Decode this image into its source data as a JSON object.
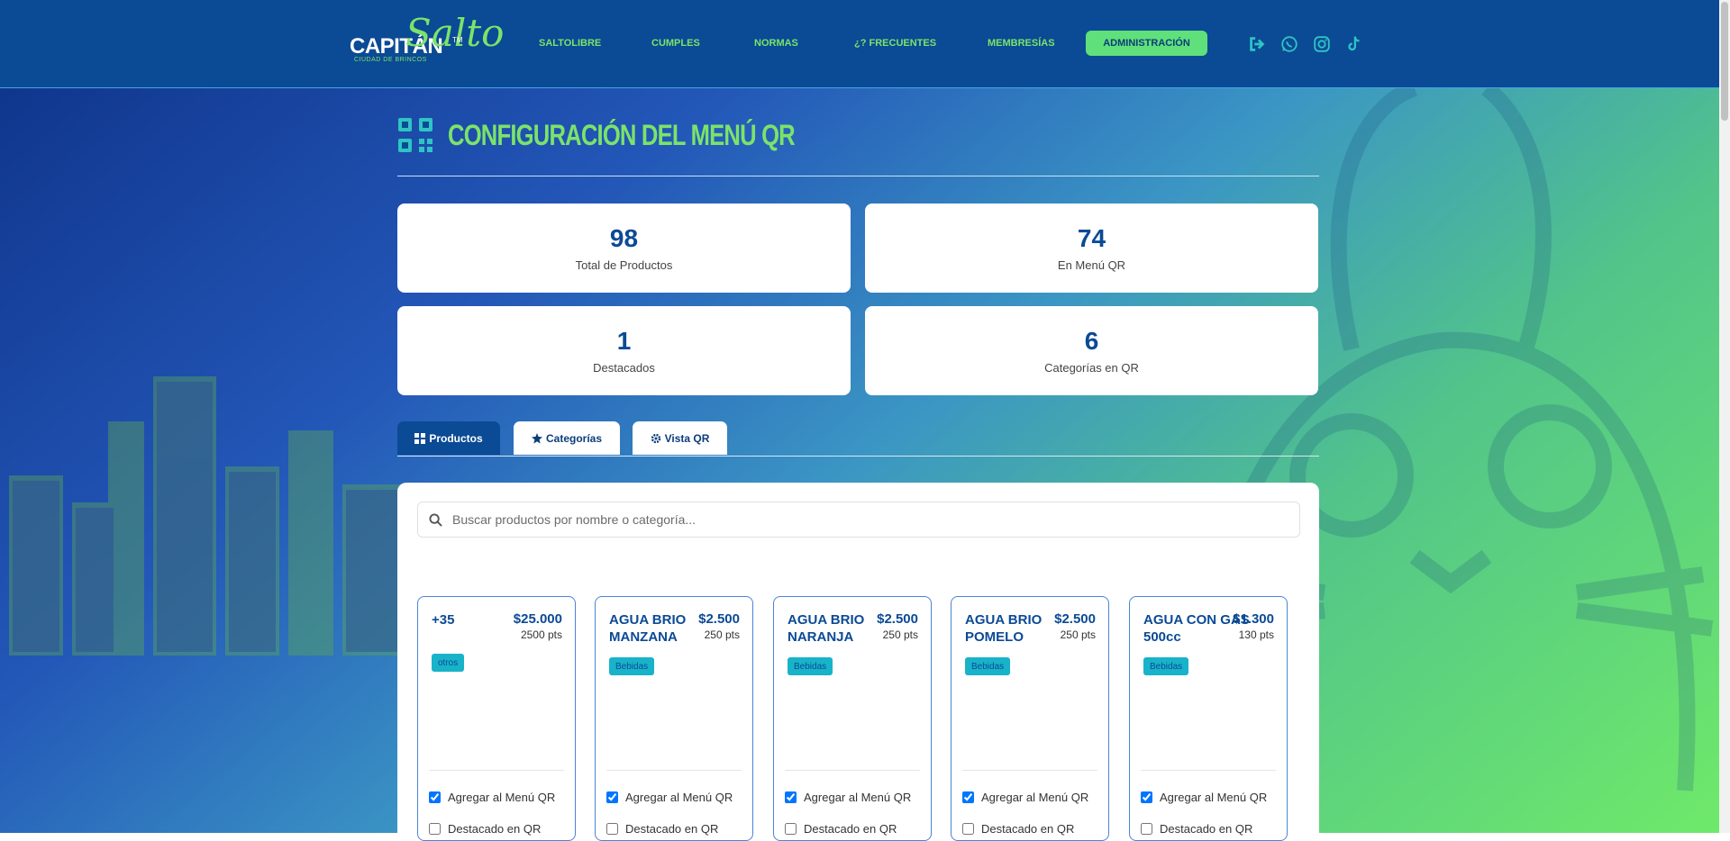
{
  "header": {
    "logo": {
      "main": "CAPITÁN",
      "script": "Salto",
      "tm": "TM",
      "tagline": "CIUDAD DE BRINCOS"
    },
    "nav": [
      "SALTOLIBRE",
      "CUMPLES",
      "NORMAS",
      "¿? FRECUENTES",
      "MEMBRESÍAS"
    ],
    "admin_label": "ADMINISTRACIÓN",
    "icons": [
      "logout-icon",
      "whatsapp-icon",
      "instagram-icon",
      "tiktok-icon"
    ]
  },
  "page": {
    "title": "CONFIGURACIÓN DEL MENÚ QR"
  },
  "stats": [
    {
      "value": "98",
      "label": "Total de Productos"
    },
    {
      "value": "74",
      "label": "En Menú QR"
    },
    {
      "value": "1",
      "label": "Destacados"
    },
    {
      "value": "6",
      "label": "Categorías en QR"
    }
  ],
  "tabs": [
    {
      "label": "Productos",
      "icon": "grid-icon",
      "active": true
    },
    {
      "label": "Categorías",
      "icon": "star-icon",
      "active": false
    },
    {
      "label": "Vista QR",
      "icon": "gear-icon",
      "active": false
    }
  ],
  "search": {
    "placeholder": "Buscar productos por nombre o categoría..."
  },
  "products": [
    {
      "name": "+35",
      "price": "$25.000",
      "points": "2500 pts",
      "category": "otros",
      "in_menu_label": "Agregar al Menú QR",
      "in_menu": true,
      "featured_label": "Destacado en QR",
      "featured": false
    },
    {
      "name": "AGUA BRIO MANZANA",
      "price": "$2.500",
      "points": "250 pts",
      "category": "Bebidas",
      "in_menu_label": "Agregar al Menú QR",
      "in_menu": true,
      "featured_label": "Destacado en QR",
      "featured": false
    },
    {
      "name": "AGUA BRIO NARANJA",
      "price": "$2.500",
      "points": "250 pts",
      "category": "Bebidas",
      "in_menu_label": "Agregar al Menú QR",
      "in_menu": true,
      "featured_label": "Destacado en QR",
      "featured": false
    },
    {
      "name": "AGUA BRIO POMELO",
      "price": "$2.500",
      "points": "250 pts",
      "category": "Bebidas",
      "in_menu_label": "Agregar al Menú QR",
      "in_menu": true,
      "featured_label": "Destacado en QR",
      "featured": false
    },
    {
      "name": "AGUA CON GAS 500cc",
      "price": "$1.300",
      "points": "130 pts",
      "category": "Bebidas",
      "in_menu_label": "Agregar al Menú QR",
      "in_menu": true,
      "featured_label": "Destacado en QR",
      "featured": false
    }
  ],
  "colors": {
    "brand_blue": "#0b4a95",
    "brand_green": "#7be36a",
    "badge": "#18b3c9"
  }
}
